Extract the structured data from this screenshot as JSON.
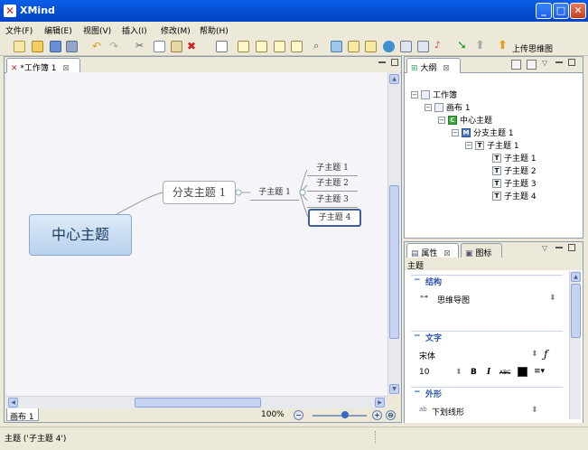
{
  "app": {
    "title": "XMind",
    "icon": "xmind-logo-icon"
  },
  "window_controls": [
    "minimize",
    "maximize",
    "close"
  ],
  "menu": [
    "文件(F)",
    "编辑(E)",
    "视图(V)",
    "插入(I)",
    "修改(M)",
    "帮助(H)"
  ],
  "toolbar": {
    "upload_label": "上传思维图"
  },
  "editor": {
    "tab_label": "*工作簿 1",
    "central_topic": "中心主题",
    "main_topic": "分支主题 1",
    "sub_topic": "子主题 1",
    "sub_topics": [
      "子主题 1",
      "子主题 2",
      "子主题 3",
      "子主题 4"
    ],
    "selected_topic": "子主题 4"
  },
  "sheet_tab": "画布 1",
  "zoom": "100%",
  "zoom_level": 0.6,
  "outline": {
    "tab_label": "大纲",
    "tree": [
      {
        "label": "工作簿",
        "icon": "workbook-icon"
      },
      {
        "label": "画布 1",
        "icon": "sheet-icon"
      },
      {
        "label": "中心主题",
        "icon": "central-topic-icon",
        "badge": "C"
      },
      {
        "label": "分支主题 1",
        "icon": "main-topic-icon",
        "badge": "M"
      },
      {
        "label": "子主题 1",
        "icon": "topic-icon",
        "badge": "T"
      },
      {
        "label": "子主题 1",
        "icon": "topic-icon",
        "badge": "T"
      },
      {
        "label": "子主题 2",
        "icon": "topic-icon",
        "badge": "T"
      },
      {
        "label": "子主题 3",
        "icon": "topic-icon",
        "badge": "T"
      },
      {
        "label": "子主题 4",
        "icon": "topic-icon",
        "badge": "T"
      }
    ]
  },
  "properties": {
    "tab_label": "属性",
    "icons_tab_label": "图标",
    "heading": "主题",
    "structure_label": "结构",
    "structure_value": "思维导图",
    "text_label": "文字",
    "font_name": "宋体",
    "font_size": "10",
    "bold": "B",
    "italic": "I",
    "strike": "ABC",
    "shape_label": "外形",
    "shape_value": "下划线形",
    "text_color": "#000000"
  },
  "status": {
    "text": "主题 ('子主题 4')"
  }
}
